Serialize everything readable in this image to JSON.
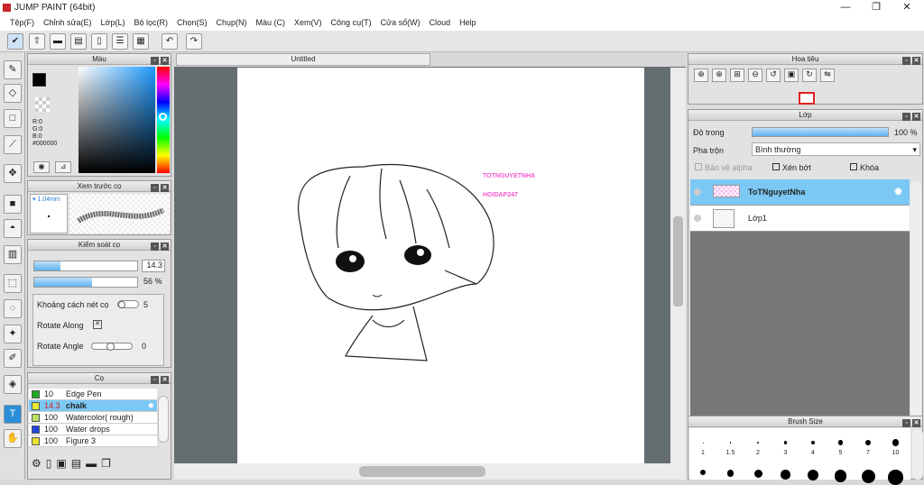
{
  "app": {
    "title": "JUMP PAINT (64bit)",
    "min": "—",
    "max": "❐",
    "close": "✕"
  },
  "menu": [
    "Tệp(F)",
    "Chỉnh sửa(E)",
    "Lớp(L)",
    "Bộ lọc(R)",
    "Chọn(S)",
    "Chụp(N)",
    "Màu (C)",
    "Xem(V)",
    "Công cụ(T)",
    "Cửa sổ(W)",
    "Cloud",
    "Help"
  ],
  "panels": {
    "color": {
      "title": "Màu",
      "r": "R:0",
      "g": "G:0",
      "b": "B:0",
      "hex": "#000000",
      "fg": "#000000",
      "bg": "#ff5555"
    },
    "preview": {
      "title": "Xem trước cọ",
      "size": "1.04mm"
    },
    "control": {
      "title": "Kiểm soát cọ",
      "size": "14.3",
      "opacity": "56 %",
      "size_fill": 0.25,
      "opacity_fill": 0.56,
      "spacing_label": "Khoảng cách nét cọ",
      "spacing_val": "5",
      "rotate_along": "Rotate Along",
      "rotate_angle": "Rotate Angle",
      "angle_val": "0"
    },
    "brushes": {
      "title": "Cọ",
      "items": [
        {
          "size": "10",
          "name": "Edge Pen",
          "color": "#22aa22"
        },
        {
          "size": "14.3",
          "name": "chalk",
          "color": "#e8e830"
        },
        {
          "size": "100",
          "name": "Watercolor( rough)",
          "color": "#b8e060"
        },
        {
          "size": "100",
          "name": "Water drops",
          "color": "#2244dd"
        },
        {
          "size": "100",
          "name": "Figure 3",
          "color": "#e8e030"
        }
      ]
    }
  },
  "canvas": {
    "tab": "Untitled",
    "wm1": "TOTNGUYETNHA",
    "wm2": "HOIDAP247"
  },
  "navigator": {
    "title": "Hoa tiêu"
  },
  "layers": {
    "title": "Lớp",
    "opacity_label": "Độ trong",
    "opacity_val": "100 %",
    "opacity_fill": 1.0,
    "blend_label": "Pha trộn",
    "blend_val": "Bình thường",
    "protect_alpha": "Bảo vệ alpha",
    "clip": "Xén bớt",
    "lock": "Khóa",
    "items": [
      {
        "name": "ToTNguyetNha",
        "selected": true
      },
      {
        "name": "Lớp1",
        "selected": false
      }
    ]
  },
  "brushsize": {
    "title": "Brush Size",
    "labels": [
      "1",
      "1.5",
      "2",
      "3",
      "4",
      "5",
      "7",
      "10"
    ]
  }
}
